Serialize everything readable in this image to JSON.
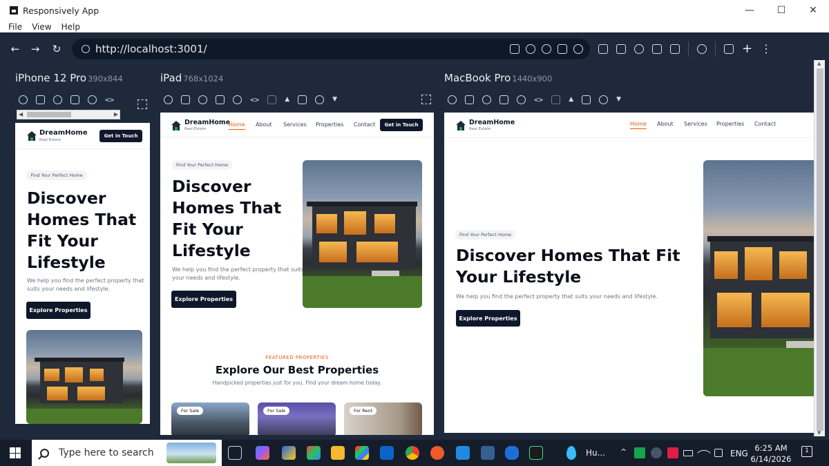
{
  "window": {
    "title": "Responsively App",
    "controls": {
      "minimize": "—",
      "maximize": "☐",
      "close": "✕"
    }
  },
  "menu": [
    "File",
    "View",
    "Help"
  ],
  "toolbar": {
    "back": "←",
    "forward": "→",
    "reload": "↻",
    "url": "http://localhost:3001/",
    "plus": "+",
    "more": "⋮"
  },
  "devices": {
    "phone": {
      "name": "iPhone 12 Pro",
      "size": "390x844"
    },
    "tablet": {
      "name": "iPad",
      "size": "768x1024"
    },
    "laptop": {
      "name": "MacBook Pro",
      "size": "1440x900"
    }
  },
  "site": {
    "brand": "DreamHome",
    "brand_sub": "Real Estate",
    "cta": "Get in Touch",
    "nav": [
      "Home",
      "About",
      "Services",
      "Properties",
      "Contact"
    ],
    "hero_pill": "Find Your Perfect Home",
    "hero_title_phone": [
      "Discover",
      "Homes That",
      "Fit Your",
      "Lifestyle"
    ],
    "hero_title_tablet": [
      "Discover",
      "Homes That",
      "Fit Your",
      "Lifestyle"
    ],
    "hero_title_laptop": [
      "Discover Homes That Fit",
      "Your Lifestyle"
    ],
    "hero_text": "We help you find the perfect property that suits your needs and lifestyle.",
    "hero_text_phone": [
      "We help you find the perfect property that",
      "suits your needs and lifestyle."
    ],
    "hero_text_tablet": [
      "We help you find the perfect property that suits",
      "your needs and lifestyle."
    ],
    "hero_button": "Explore Properties",
    "featured_tag": "FEATURED PROPERTIES",
    "featured_title": "Explore Our Best Properties",
    "featured_sub": "Handpicked properties just for you. Find your dream home today.",
    "cards": [
      {
        "badge": "For Sale"
      },
      {
        "badge": "For Sale"
      },
      {
        "badge": "For Rent"
      }
    ]
  },
  "taskbar": {
    "search_placeholder": "Type here to search",
    "weather_text": "Hu...",
    "language": "ENG",
    "time": "6:25 AM",
    "date": "6/14/2026",
    "notifications": "1"
  }
}
